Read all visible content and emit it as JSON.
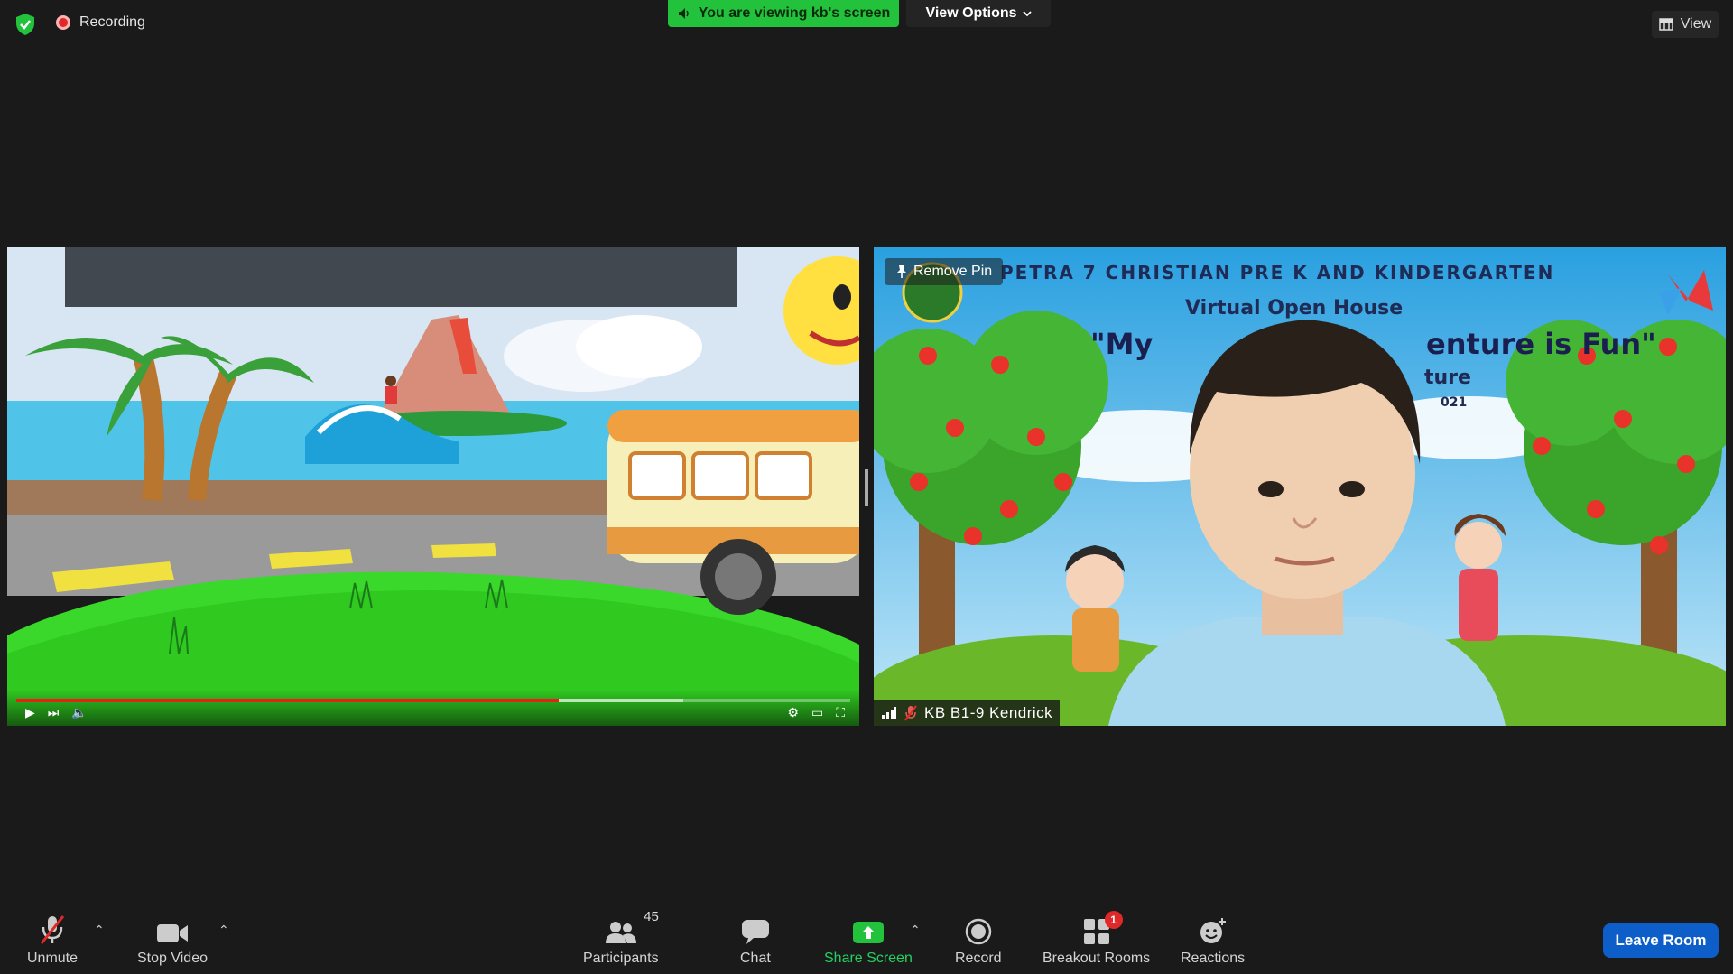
{
  "topbar": {
    "recording_label": "Recording",
    "viewing_banner": "You are viewing kb's screen",
    "view_options_label": "View Options",
    "view_label": "View"
  },
  "tiles": {
    "left": {
      "kind": "shared-screen-video",
      "progress_played": 0.65,
      "progress_buffered": 0.8
    },
    "right": {
      "remove_pin_label": "Remove Pin",
      "participant_name": "KB B1-9 Kendrick",
      "background_texts": {
        "line1": "PETRA 7 CHRISTIAN PRE K AND KINDERGARTEN",
        "line2": "Virtual Open House",
        "line3a": "\"My",
        "line3b": "enture is Fun\"",
        "line4": "ture",
        "line5": "021"
      }
    }
  },
  "toolbar": {
    "unmute": "Unmute",
    "stop_video": "Stop Video",
    "participants": "Participants",
    "participants_count": "45",
    "chat": "Chat",
    "share_screen": "Share Screen",
    "record": "Record",
    "breakout_rooms": "Breakout Rooms",
    "breakout_badge": "1",
    "reactions": "Reactions",
    "leave_room": "Leave Room"
  },
  "colors": {
    "accent_green": "#23c23c",
    "leave_blue": "#0e5ec9",
    "record_red": "#e02828"
  }
}
